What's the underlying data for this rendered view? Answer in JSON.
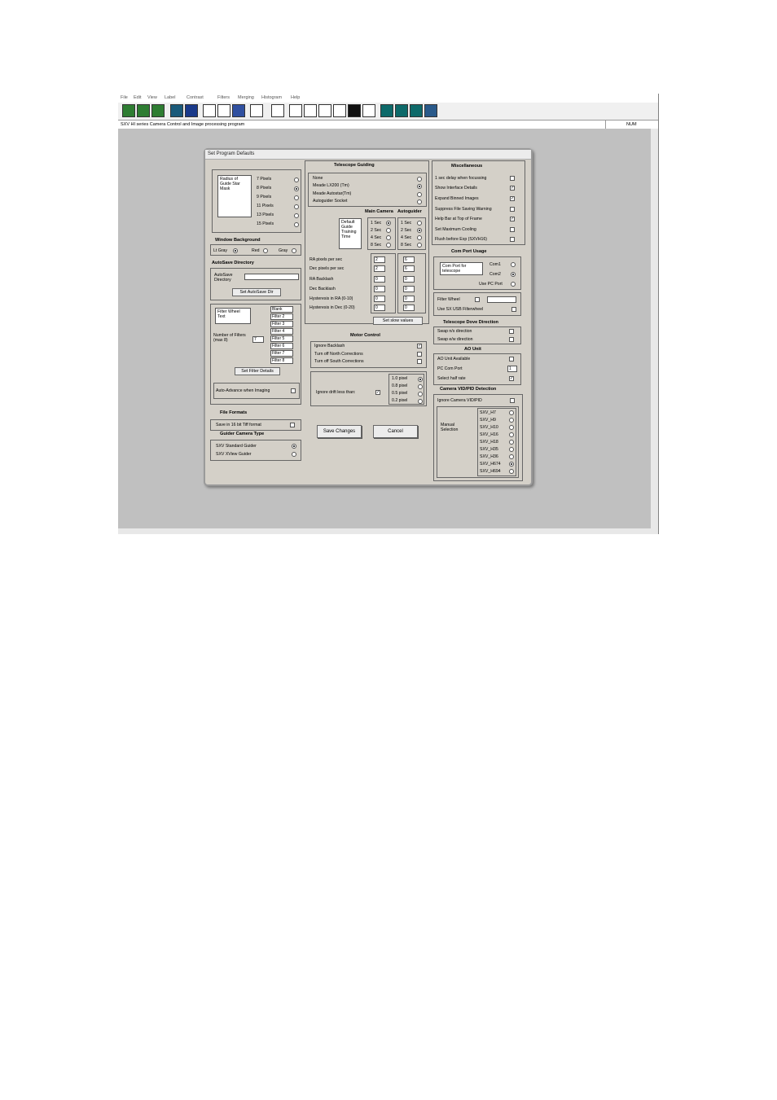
{
  "menubar": [
    "File",
    "Edit",
    "View",
    "Label",
    "Contrast",
    "Filters",
    "Merging",
    "Histogram",
    "Help"
  ],
  "statusbar": {
    "text": "SXV HI series Camera Control and Image processing program",
    "num": "NUM"
  },
  "toolbar_icons": [
    "open-green-icon",
    "save-green-icon",
    "reopen-green-icon",
    "camera-link-icon",
    "window-icon",
    "overlay-icon",
    "diagonal-tool-icon",
    "text-tool-icon",
    "calculator-icon",
    "histogram-1-icon",
    "histogram-2-icon",
    "histogram-3-icon",
    "histogram-4-icon",
    "eye-icon",
    "histogram-5-icon",
    "view-1-icon",
    "view-2-icon",
    "view-3-icon",
    "view-4-icon"
  ],
  "dialog": {
    "title": "Set Program Defaults",
    "left": {
      "radius_label": "Radius of Guide Star Mask",
      "radius_options": [
        {
          "label": "7 Pixels",
          "on": false
        },
        {
          "label": "8 Pixels",
          "on": true
        },
        {
          "label": "9 Pixels",
          "on": false
        },
        {
          "label": "11 Pixels",
          "on": false
        },
        {
          "label": "13 Pixels",
          "on": false
        },
        {
          "label": "15 Pixels",
          "on": false
        }
      ],
      "window_bg_title": "Window Background",
      "window_bg": [
        {
          "label": "Lt Gray",
          "on": true
        },
        {
          "label": "Red",
          "on": false
        },
        {
          "label": "Gray",
          "on": false
        }
      ],
      "autosave_title": "AutoSave Directory",
      "autosave_label": "AutoSave Directory",
      "autosave_value": "",
      "set_autosave_btn": "Set AutoSave Dir",
      "filter_wheel_text": "Filter Wheel Text",
      "filters": [
        "Blank",
        "Filter 2",
        "Filter 3",
        "Filter 4",
        "Filter 5",
        "Filter 6",
        "Filter 7",
        "Filter 8"
      ],
      "num_filters_label": "Number of Filters (max 8)",
      "num_filters": "7",
      "set_filter_btn": "Set Filter Details",
      "auto_advance": "Auto-Advance when Imaging",
      "file_formats_title": "File Formats",
      "save16": "Save in 16 bit Tiff format",
      "guider_type_title": "Guider Camera Type",
      "guider_types": [
        {
          "label": "SXV Standard Guider",
          "on": true
        },
        {
          "label": "SXV XView Guider",
          "on": false
        }
      ]
    },
    "middle": {
      "telescope_title": "Telescope Guiding",
      "guiding_options": [
        {
          "label": "None",
          "on": false
        },
        {
          "label": "Meade LX200 (Tm)",
          "on": true
        },
        {
          "label": "Meade Autostar(Tm)",
          "on": false
        },
        {
          "label": "Autoguider Socket",
          "on": false
        }
      ],
      "main_cam_label": "Main Camera",
      "autoguider_label": "Autoguider",
      "default_guide_label": "Default Guide Training Time",
      "main_times": [
        {
          "label": "1 Sec",
          "on": true
        },
        {
          "label": "2 Sec",
          "on": false
        },
        {
          "label": "4 Sec",
          "on": false
        },
        {
          "label": "8 Sec",
          "on": false
        }
      ],
      "auto_times": [
        {
          "label": "1 Sec",
          "on": false
        },
        {
          "label": "2 Sec",
          "on": true
        },
        {
          "label": "4 Sec",
          "on": false
        },
        {
          "label": "8 Sec",
          "on": false
        }
      ],
      "params": [
        {
          "label": "RA pixels per sec",
          "main": "2",
          "auto": "6"
        },
        {
          "label": "Dec pixels per sec",
          "main": "2",
          "auto": "6"
        },
        {
          "label": "RA Backlash",
          "main": "0",
          "auto": "0"
        },
        {
          "label": "Dec Backlash",
          "main": "0",
          "auto": "0"
        },
        {
          "label": "Hysteresis in RA (0-10)",
          "main": "0",
          "auto": "0"
        },
        {
          "label": "Hysteresis in Dec (0-20)",
          "main": "0",
          "auto": "0"
        }
      ],
      "set_slow_btn": "Set slow values",
      "motor_title": "Motor Control",
      "motor": [
        {
          "label": "Ignore Backlash",
          "checked": true
        },
        {
          "label": "Turn off North Corrections",
          "checked": false
        },
        {
          "label": "Turn off South Corrections",
          "checked": false
        }
      ],
      "drift_label": "Ignore drift less than:",
      "drift_checked": true,
      "drift_options": [
        {
          "label": "1.0 pixel",
          "on": true
        },
        {
          "label": "0.8 pixel",
          "on": false
        },
        {
          "label": "0.5 pixel",
          "on": false
        },
        {
          "label": "0.2 pixel",
          "on": false
        }
      ],
      "save_btn": "Save Changes",
      "cancel_btn": "Cancel"
    },
    "right": {
      "misc_title": "Miscellaneous",
      "misc": [
        {
          "label": "1 sec delay when focussing",
          "checked": false
        },
        {
          "label": "Show Interface Details",
          "checked": true
        },
        {
          "label": "Expand Binned Images",
          "checked": true
        },
        {
          "label": "Suppress File Saving Warning",
          "checked": false
        },
        {
          "label": "Help Bar at Top of Frame",
          "checked": true
        },
        {
          "label": "Set Maximum Cooling",
          "checked": false
        },
        {
          "label": "Flush before Exp (SXVH16)",
          "checked": false
        }
      ],
      "com_title": "Com Port Usage",
      "com_label": "Com Port for telescope",
      "com_options": [
        {
          "label": "Com1",
          "on": false
        },
        {
          "label": "Com2",
          "on": true
        },
        {
          "label": "Use PC Port",
          "on": false
        }
      ],
      "filter_wheel_label": "Filter Wheel",
      "filter_wheel_value": "",
      "sx_usb": "Use SX USB Filterwheel",
      "dove_title": "Telescope Dove Direction",
      "dove": [
        {
          "label": "Swap n/s direction",
          "checked": false
        },
        {
          "label": "Swap e/w direction",
          "checked": false
        }
      ],
      "ao_title": "AO Unit",
      "ao_available": "AO Unit Available",
      "pc_com_label": "PC Com Port",
      "pc_com_value": "1",
      "half_rate": "Select half rate",
      "vid_title": "Camera VID/PID Detection",
      "ignore_vid": "Ignore Camera VID/PID",
      "manual_label": "Manual Selection",
      "models": [
        {
          "label": "SXV_H7",
          "on": false
        },
        {
          "label": "SXV_H9",
          "on": false
        },
        {
          "label": "SXV_H10",
          "on": false
        },
        {
          "label": "SXV_H16",
          "on": false
        },
        {
          "label": "SXV_H18",
          "on": false
        },
        {
          "label": "SXV_H35",
          "on": false
        },
        {
          "label": "SXV_H36",
          "on": false
        },
        {
          "label": "SXV_H674",
          "on": true
        },
        {
          "label": "SXV_H694",
          "on": false
        }
      ]
    }
  }
}
